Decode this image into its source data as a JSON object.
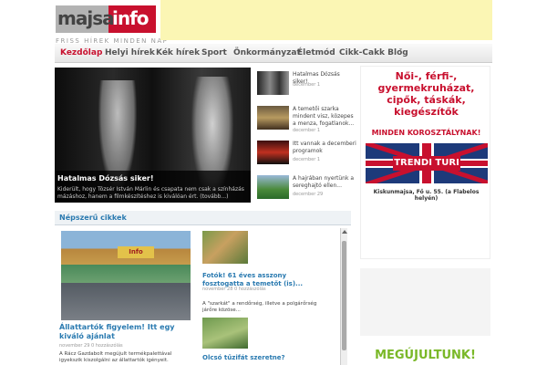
{
  "logo": {
    "part1": "majsa",
    "part2": "info",
    "tagline": "FRISS HÍREK MINDEN NAP"
  },
  "nav": {
    "items": [
      "Kezdőlap",
      "Helyi hírek",
      "Kék hírek",
      "Sport",
      "Önkormányzat",
      "Életmód",
      "Cikk-Cakk Blog"
    ]
  },
  "featured": {
    "title": "Hatalmas Dózsás siker!",
    "excerpt": "Kiderült, hogy Tózsér István Márlin és csapata nem csak a színházás mázáshoz, hanem a filmkészítéshez is kiválóan ért. (tovább...)"
  },
  "thumbs": [
    {
      "title": "Hatalmas Dózsás siker!",
      "date": "december 1"
    },
    {
      "title": "A temetői szarka mindent visz, közepes a menza, fogatlanok...",
      "date": "december 1"
    },
    {
      "title": "Itt vannak a decemberi programok",
      "date": "december 1"
    },
    {
      "title": "A hajrában nyertünk a sereghajtó ellen...",
      "date": "december 29"
    }
  ],
  "popular": {
    "heading": "Népszerű cikkek",
    "items": [
      {
        "sign": "Info",
        "title": "Állattartók figyelem! Itt egy kiváló ajánlat",
        "meta": "november 29    0 hozzászólás",
        "excerpt": "A Rácz Gazdabolt megújult termékpalettával igyekszik kiszolgálni az állattartók igényeit."
      },
      {
        "title": "Fotók! 61 éves asszony fosztogatta a temetőt (is)...",
        "meta": "november 28    0 hozzászólás",
        "excerpt": "A \"szarkát\" a rendőrség, illetve a polgárőrség járőre közöse..."
      },
      {
        "title": "Olcsó tűzifát szeretne?"
      }
    ]
  },
  "ad": {
    "line1": "Női-, férfi-,",
    "line2": "gyermekruházat,",
    "line3": "cipők, táskák,",
    "line4": "kiegészítők",
    "line5": "MINDEN KOROSZTÁLYNAK!",
    "brand": "TRENDI TURI",
    "address": "Kiskunmajsa, Fő u. 55. (a Flabelos helyén)"
  },
  "ad3": {
    "text": "MEGÚJULTUNK!"
  },
  "colors": {
    "brand_red": "#c8102e",
    "link_blue": "#2a7ab0",
    "ad_green": "#7ab828",
    "top_ad_yellow": "#fbf6b4"
  }
}
